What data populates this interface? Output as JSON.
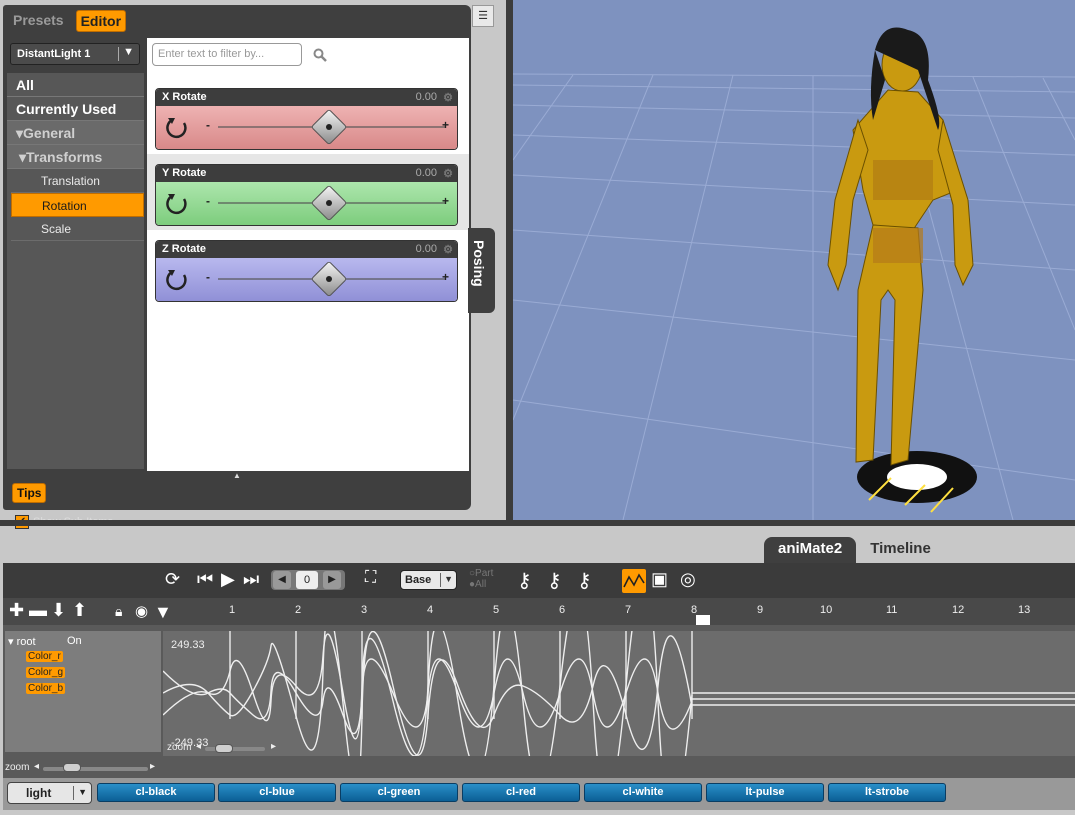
{
  "pane": {
    "tabs": [
      {
        "label": "Presets"
      },
      {
        "label": "Editor"
      }
    ],
    "node_select": "DistantLight 1",
    "categories": {
      "all": "All",
      "currently_used": "Currently Used",
      "general": "General",
      "transforms": "Transforms",
      "items": [
        "Translation",
        "Rotation",
        "Scale"
      ],
      "selected": "Rotation"
    },
    "show_sub_items": "Show Sub Items",
    "filter_placeholder": "Enter text to filter by...",
    "params": [
      {
        "label": "X Rotate",
        "value": "0.00",
        "color": "#e8a0a0"
      },
      {
        "label": "Y Rotate",
        "value": "0.00",
        "color": "#9edc9e"
      },
      {
        "label": "Z Rotate",
        "value": "0.00",
        "color": "#a8a8e6"
      }
    ],
    "posing_tab": "Posing",
    "tips": "Tips"
  },
  "anim": {
    "tabs": [
      {
        "label": "aniMate2"
      },
      {
        "label": "Timeline"
      }
    ],
    "frame": "0",
    "base": "Base",
    "part": "Part",
    "all": "All",
    "ruler": [
      "1",
      "2",
      "3",
      "4",
      "5",
      "6",
      "7",
      "8",
      "9",
      "10",
      "11",
      "12",
      "13"
    ],
    "tree": {
      "root": "root",
      "on": "On",
      "channels": [
        "Color_r",
        "Color_g",
        "Color_b"
      ]
    },
    "graph": {
      "max": "249.33",
      "min": "-249.33"
    },
    "zoom": "zoom",
    "light_select": "light",
    "presets": [
      "cl-black",
      "cl-blue",
      "cl-green",
      "cl-red",
      "cl-white",
      "lt-pulse",
      "lt-strobe"
    ]
  },
  "colors": {
    "accent": "#ff9a00",
    "viewport": "#7e92bf",
    "preset_blue": "#1a78b5"
  }
}
